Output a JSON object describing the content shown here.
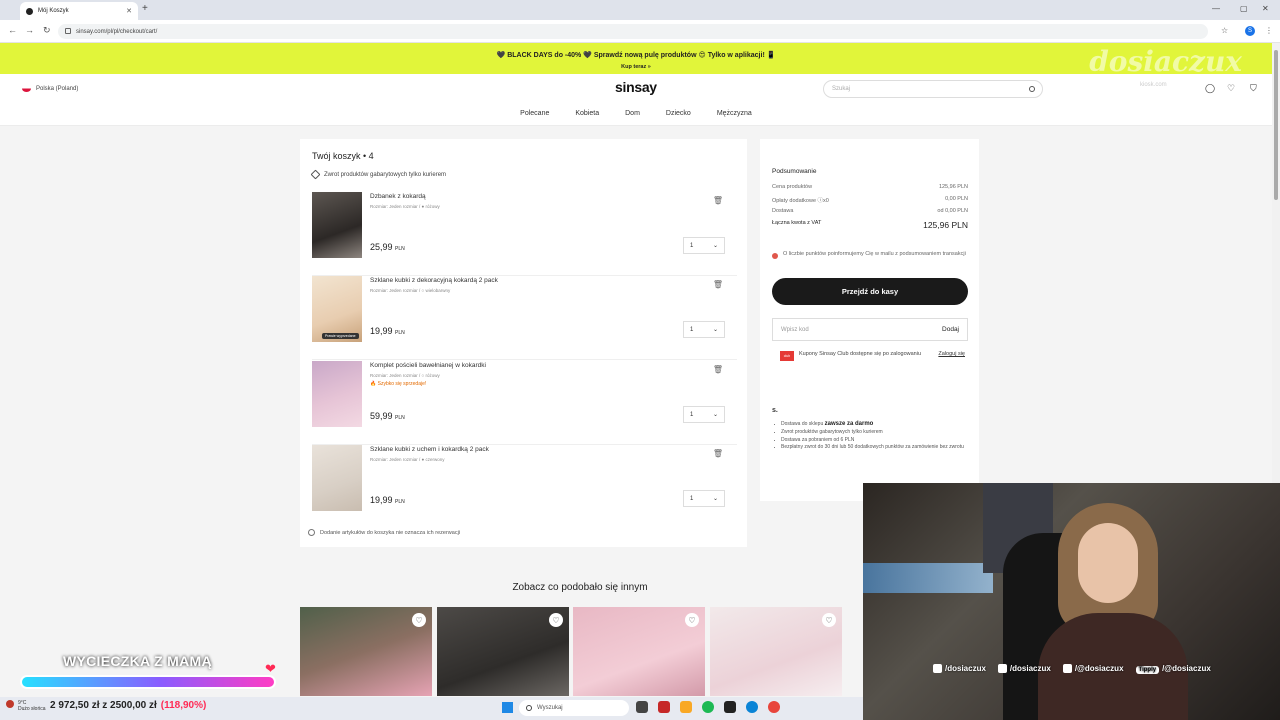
{
  "browser": {
    "tab_title": "Mój Koszyk",
    "tab_close": "✕",
    "new_tab": "+",
    "url": "sinsay.com/pl/pl/checkout/cart/",
    "ext_label": "S"
  },
  "promo": {
    "text": "🖤 BLACK DAYS do -40% 🖤 Sprawdź nową pulę produktów 😍 Tylko w aplikacji! 📱",
    "link": "Kup teraz »"
  },
  "watermark": "dosiaczux",
  "header": {
    "country": "Polska (Poland)",
    "logo": "sinsay",
    "search_placeholder": "Szukaj",
    "kiosk": "kiosk.com",
    "nav": [
      "Polecane",
      "Kobieta",
      "Dom",
      "Dziecko",
      "Mężczyzna"
    ]
  },
  "cart": {
    "title": "Twój koszyk • 4",
    "note": "Zwrot produktów gabarytowych tylko kurierem",
    "footer": "Dodanie artykułów do koszyka nie oznacza ich rezerwacji",
    "items": [
      {
        "name": "Dzbanek z kokardą",
        "meta": "Rozmiar: Jeden rozmiar / ● różowy",
        "flag": "",
        "price_main": "25,99",
        "currency": "PLN",
        "qty": "1",
        "badge": ""
      },
      {
        "name": "Szklane kubki z dekoracyjną kokardą 2 pack",
        "meta": "Rozmiar: Jeden rozmiar / ○ wielobarwny",
        "flag": "",
        "price_main": "19,99",
        "currency": "PLN",
        "qty": "1",
        "badge": "Prawie wyprzedane"
      },
      {
        "name": "Komplet pościeli bawełnianej w kokardki",
        "meta": "Rozmiar: Jeden rozmiar / ○ różowy",
        "flag": "🔥 Szybko się sprzedaje!",
        "price_main": "59,99",
        "currency": "PLN",
        "qty": "1",
        "badge": ""
      },
      {
        "name": "Szklane kubki z uchem i kokardką 2 pack",
        "meta": "Rozmiar: Jeden rozmiar / ● czerwony",
        "flag": "",
        "price_main": "19,99",
        "currency": "PLN",
        "qty": "1",
        "badge": ""
      }
    ]
  },
  "summary": {
    "title": "Podsumowanie",
    "rows": [
      {
        "label": "Cena produktów",
        "value": "125,96 PLN"
      },
      {
        "label": "Opłaty dodatkowe ⓘx0",
        "value": "0,00 PLN"
      },
      {
        "label": "Dostawa",
        "value": "od 0,00 PLN"
      }
    ],
    "total_label": "Łączna kwota z VAT",
    "total_value": "125,96 PLN",
    "points_note": "O liczbie punktów poinformujemy Cię w mailu z podsumowaniem transakcji",
    "checkout": "Przejdź do kasy",
    "code_placeholder": "Wpisz kod",
    "code_add": "Dodaj",
    "club_logo": "club",
    "club_text": "Kupony Sinsay Club dostępne się po zalogowaniu",
    "club_login": "Zaloguj się",
    "perks_logo": "s.",
    "perks": [
      {
        "strong": "zawsze za darmo",
        "text": "Dostawa do sklepu "
      },
      {
        "strong": "",
        "text": "Zwrot produktów gabarytowych tylko kurierem"
      },
      {
        "strong": "",
        "text": "Dostawa za pobraniem od 6 PLN"
      },
      {
        "strong": "",
        "text": "Bezpłatny zwrot do 30 dni lub 50 dodatkowych punktów za zamówienie bez zwrotu"
      }
    ]
  },
  "reco": {
    "title": "Zobacz co podobało się innym",
    "heart": "♡"
  },
  "stream": {
    "socials": [
      "/dosiaczux",
      "/dosiaczux",
      "/@dosiaczux",
      "/@dosiaczux"
    ],
    "tippy": "Tipply",
    "goal_title": "WYCIECZKA Z MAMĄ",
    "goal_amount": "2 972,50 zł z 2500,00 zł",
    "goal_pct": "(118,90%)",
    "goal_progress": 1.0,
    "heart": "❤"
  },
  "taskbar": {
    "weather_temp": "9°C",
    "weather_desc": "Dużo słońca",
    "search": "Wyszukaj"
  },
  "colors": {
    "promo": "#e1f53a",
    "checkout": "#1a1a1a",
    "accent_red": "#e0574c"
  }
}
